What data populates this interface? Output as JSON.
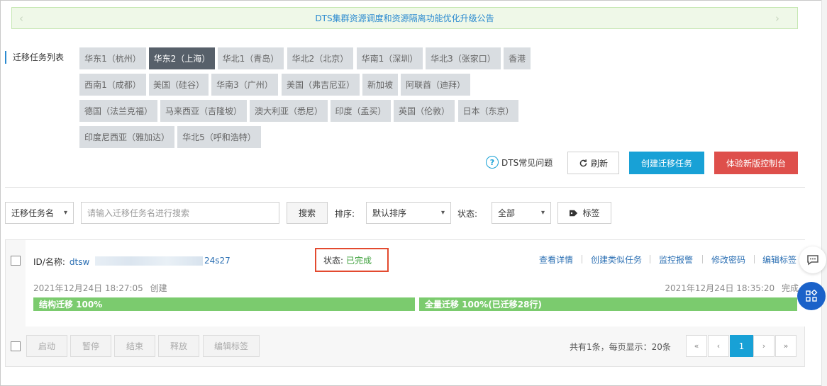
{
  "notice": {
    "text": "DTS集群资源调度和资源隔离功能优化升级公告",
    "prev_arrow": "‹",
    "next_arrow": "›"
  },
  "regions": {
    "title": "迁移任务列表",
    "items": [
      {
        "label": "华东1（杭州）",
        "active": false
      },
      {
        "label": "华东2（上海）",
        "active": true
      },
      {
        "label": "华北1（青岛）",
        "active": false
      },
      {
        "label": "华北2（北京）",
        "active": false
      },
      {
        "label": "华南1（深圳）",
        "active": false
      },
      {
        "label": "华北3（张家口）",
        "active": false
      },
      {
        "label": "香港",
        "active": false
      },
      {
        "label": "西南1（成都）",
        "active": false
      },
      {
        "label": "美国（硅谷）",
        "active": false
      },
      {
        "label": "华南3（广州）",
        "active": false
      },
      {
        "label": "美国（弗吉尼亚）",
        "active": false
      },
      {
        "label": "新加坡",
        "active": false
      },
      {
        "label": "阿联酋（迪拜）",
        "active": false
      },
      {
        "label": "德国（法兰克福）",
        "active": false
      },
      {
        "label": "马来西亚（吉隆坡）",
        "active": false
      },
      {
        "label": "澳大利亚（悉尼）",
        "active": false
      },
      {
        "label": "印度（孟买）",
        "active": false
      },
      {
        "label": "英国（伦敦）",
        "active": false
      },
      {
        "label": "日本（东京）",
        "active": false
      },
      {
        "label": "印度尼西亚（雅加达）",
        "active": false
      },
      {
        "label": "华北5（呼和浩特）",
        "active": false
      }
    ]
  },
  "actions": {
    "faq_icon": "?",
    "faq_label": "DTS常见问题",
    "refresh_label": "刷新",
    "create_label": "创建迁移任务",
    "new_console_label": "体验新版控制台"
  },
  "filter": {
    "field_select": "迁移任务名",
    "search_placeholder": "请输入迁移任务名进行搜索",
    "search_value": "",
    "search_label": "搜索",
    "sort_label": "排序:",
    "sort_select": "默认排序",
    "status_label": "状态:",
    "status_select": "全部",
    "tag_label": "标签"
  },
  "task": {
    "id_label": "ID/名称:",
    "id_prefix": "dtsw",
    "id_suffix": "24s27",
    "status_label": "状态:",
    "status_value": "已完成",
    "links": [
      "查看详情",
      "创建类似任务",
      "监控报警",
      "修改密码",
      "编辑标签"
    ],
    "created_time": "2021年12月24日 18:27:05",
    "created_label": "创建",
    "finished_time": "2021年12月24日 18:35:20",
    "finished_label": "完成",
    "progress_struct": "结构迁移  100%",
    "progress_full": "全量迁移  100%(已迁移28行)",
    "progress_struct_pct": 100,
    "progress_full_pct": 100
  },
  "footer": {
    "buttons": [
      "启动",
      "暂停",
      "结束",
      "释放",
      "编辑标签"
    ],
    "page_info": "共有1条，每页显示：20条",
    "pager": [
      "«",
      "‹",
      "1",
      "›",
      "»"
    ]
  },
  "colors": {
    "accent": "#18a1d6",
    "danger": "#de4f4b",
    "success": "#3c9f3a",
    "highlight": "#e34a2f"
  }
}
